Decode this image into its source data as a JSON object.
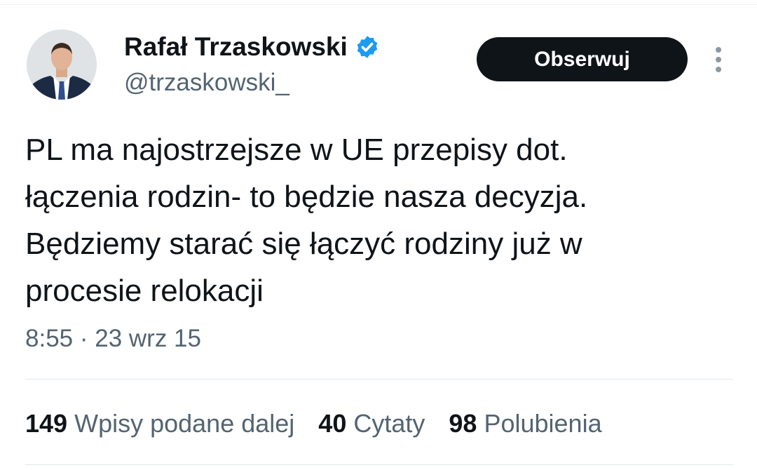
{
  "author": {
    "display_name": "Rafał Trzaskowski",
    "handle": "@trzaskowski_",
    "verified": true,
    "verified_color": "#1d9bf0",
    "avatar_icon": "profile-photo"
  },
  "follow_button": {
    "label": "Obserwuj"
  },
  "more_menu": {
    "icon": "more-vertical-icon"
  },
  "tweet": {
    "lines": [
      "PL ma najostrzejsze w UE przepisy dot.",
      "łączenia rodzin- to będzie nasza decyzja.",
      "Będziemy starać się łączyć rodziny już w",
      "procesie relokacji"
    ],
    "time": "8:55",
    "separator": "·",
    "date": "23 wrz 15"
  },
  "stats": [
    {
      "count": "149",
      "label": "Wpisy podane dalej"
    },
    {
      "count": "40",
      "label": "Cytaty"
    },
    {
      "count": "98",
      "label": "Polubienia"
    }
  ],
  "colors": {
    "text_primary": "#0f1419",
    "text_secondary": "#536471",
    "button_bg": "#0f1419",
    "button_text": "#ffffff",
    "divider": "#e1e8ed"
  }
}
